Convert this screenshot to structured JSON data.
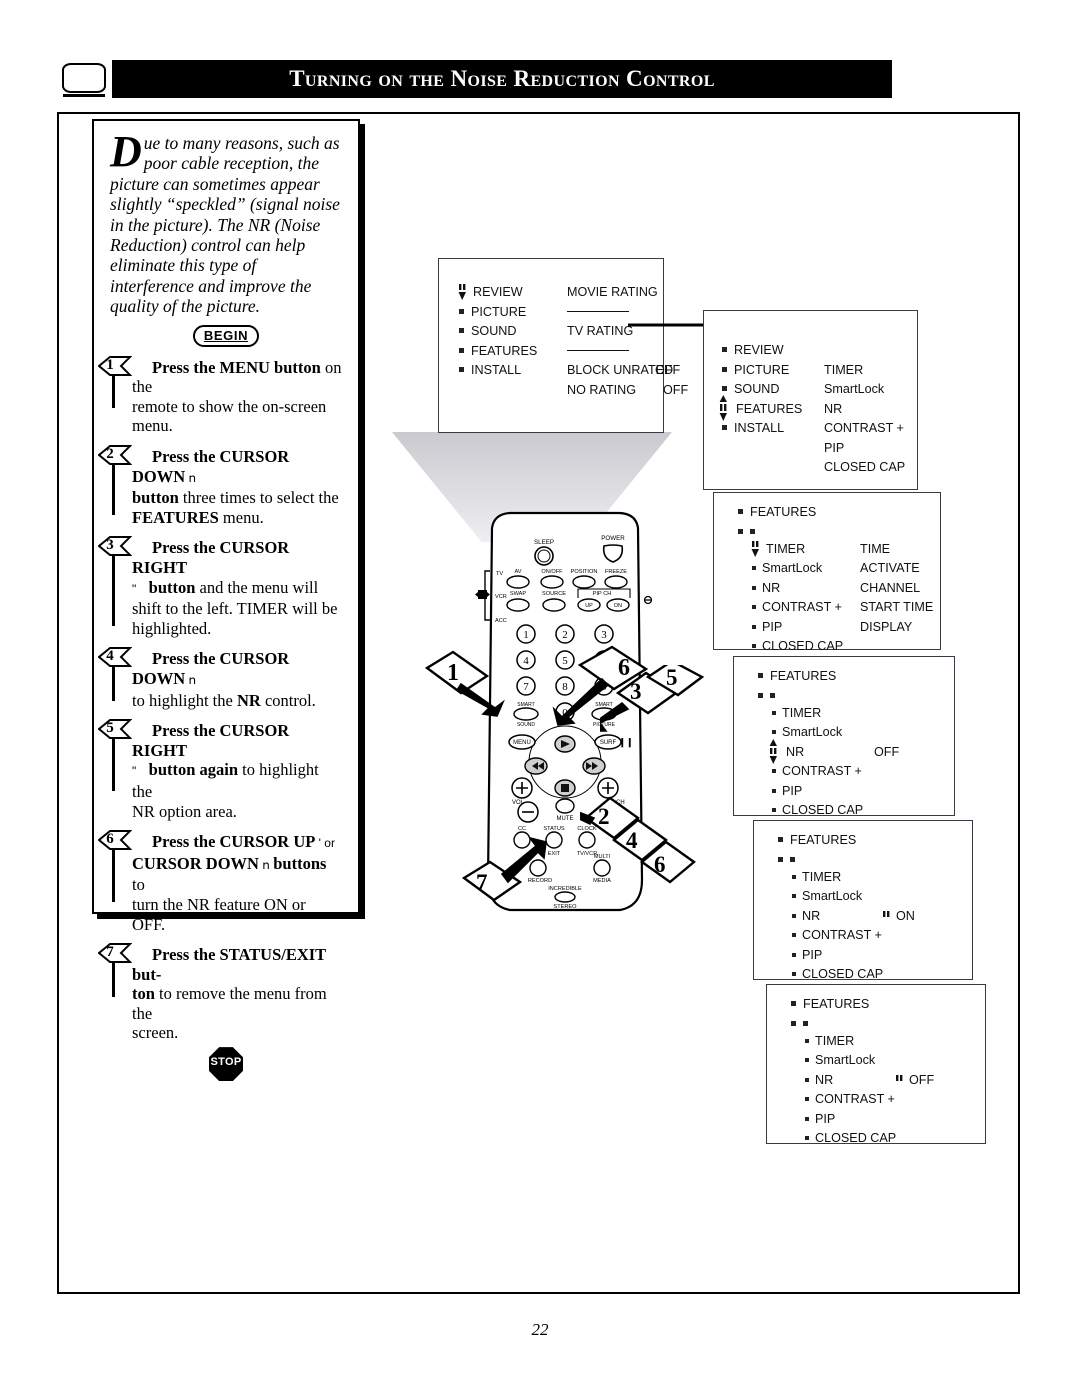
{
  "header": {
    "title": "Turning on the Noise Reduction Control",
    "tv_icon": "tv-screen-icon"
  },
  "instructions": {
    "intro_dropcap": "D",
    "intro_text": "ue to many reasons, such as poor cable reception, the picture can sometimes appear slightly “speckled” (signal noise in the picture). The NR (Noise Reduction) control can help eliminate this type of interference and improve the quality of the picture.",
    "begin_label": "BEGIN",
    "stop_label": "STOP",
    "steps": [
      {
        "number": "1",
        "line1_bold": "Press the MENU button",
        "line1_rest": " on the",
        "line2": "remote to show the on-screen menu."
      },
      {
        "number": "2",
        "line1_bold": "Press the CURSOR DOWN",
        "line1_rest": " ո",
        "line2_bold": "button",
        "line2_rest": " three times to select the",
        "line3_bold": "FEATURES",
        "line3_rest": " menu."
      },
      {
        "number": "3",
        "line1_bold": "Press the CURSOR RIGHT",
        "line2_pre": "\"",
        "line2_bold": "button",
        "line2_rest": " and the menu will",
        "line3": "shift to the left. TIMER will be",
        "line4": "highlighted."
      },
      {
        "number": "4",
        "line1_bold": "Press the CURSOR DOWN",
        "line1_rest": " ո",
        "line2_pre": "to highlight the ",
        "line2_bold": "NR",
        "line2_rest": " control."
      },
      {
        "number": "5",
        "line1_bold": "Press the CURSOR RIGHT",
        "line2_pre": "\"",
        "line2_bold": "button again",
        "line2_rest": " to highlight the",
        "line3": "NR option area."
      },
      {
        "number": "6",
        "line1_bold": "Press the CURSOR UP",
        "line1_rest": " '    or",
        "line2_bold": "CURSOR DOWN",
        "line2_mid": " ո ",
        "line2_bold2": "buttons",
        "line2_rest": " to",
        "line3": "turn the NR feature ON or OFF."
      },
      {
        "number": "7",
        "line1_bold": "Press the STATUS/EXIT but-",
        "line2_bold": "ton",
        "line2_rest": " to remove the menu from the",
        "line3": "screen."
      }
    ]
  },
  "osd_screens": [
    {
      "id": "menu-main-ratings",
      "left_column": [
        "REVIEW",
        "PICTURE",
        "SOUND",
        "FEATURES",
        "INSTALL"
      ],
      "right_column": [
        {
          "label": "MOVIE RATING",
          "value": ""
        },
        {
          "label": "————",
          "value": ""
        },
        {
          "label": "TV RATING",
          "value": ""
        },
        {
          "label": "————",
          "value": ""
        },
        {
          "label": "BLOCK UNRATED",
          "value": "OFF"
        },
        {
          "label": "NO RATING",
          "value": "OFF"
        }
      ],
      "cursor_on": "REVIEW"
    },
    {
      "id": "menu-features-list",
      "left_column": [
        "REVIEW",
        "PICTURE",
        "SOUND",
        "FEATURES",
        "INSTALL"
      ],
      "right_column": [
        {
          "label": "",
          "value": ""
        },
        {
          "label": "TIMER",
          "value": ""
        },
        {
          "label": "SmartLock",
          "value": ""
        },
        {
          "label": "NR",
          "value": ""
        },
        {
          "label": "CONTRAST +",
          "value": ""
        },
        {
          "label": "PIP",
          "value": ""
        },
        {
          "label": "CLOSED CAP",
          "value": ""
        }
      ],
      "cursor_on": "FEATURES"
    },
    {
      "id": "menu-timer-highlighted",
      "title": "FEATURES",
      "left_column": [
        "TIMER",
        "SmartLock",
        "NR",
        "CONTRAST +",
        "PIP",
        "CLOSED CAP"
      ],
      "right_column": [
        "TIME",
        "ACTIVATE",
        "CHANNEL",
        "START TIME",
        "DISPLAY",
        ""
      ],
      "cursor_on": "TIMER"
    },
    {
      "id": "menu-nr-off-selected",
      "title": "FEATURES",
      "left_column": [
        "TIMER",
        "SmartLock",
        "NR",
        "CONTRAST +",
        "PIP",
        "CLOSED CAP"
      ],
      "right_column": [
        "",
        "",
        "OFF",
        "",
        "",
        ""
      ],
      "cursor_on": "NR"
    },
    {
      "id": "menu-nr-on",
      "title": "FEATURES",
      "left_column": [
        "TIMER",
        "SmartLock",
        "NR",
        "CONTRAST +",
        "PIP",
        "CLOSED CAP"
      ],
      "right_column": [
        "",
        "",
        "ON",
        "",
        "",
        ""
      ],
      "value_cursor": "ON"
    },
    {
      "id": "menu-nr-off",
      "title": "FEATURES",
      "left_column": [
        "TIMER",
        "SmartLock",
        "NR",
        "CONTRAST +",
        "PIP",
        "CLOSED CAP"
      ],
      "right_column": [
        "",
        "",
        "OFF",
        "",
        "",
        ""
      ],
      "value_cursor": "OFF"
    }
  ],
  "remote": {
    "labels": {
      "sleep": "SLEEP",
      "power": "POWER",
      "tv": "TV",
      "vcr": "VCR",
      "acc": "ACC",
      "av": "AV",
      "onoff": "ON/OFF",
      "position": "POSITION",
      "freeze": "FREEZE",
      "swap": "SWAP",
      "source": "SOURCE",
      "pipch": "PIP CH",
      "up": "UP",
      "dn": "DN",
      "smart_sound": "SMART SOUND",
      "smart_picture": "SMART PICTURE",
      "menu": "MENU",
      "surf": "SURF",
      "vol": "VOL",
      "ch": "CH",
      "mute": "MUTE",
      "cc": "CC",
      "status_exit": "STATUS EXIT",
      "clock": "CLOCK",
      "tv_vcr": "TV/VCR",
      "record": "RECORD",
      "multi_media": "MULTI MEDIA",
      "incredible_stereo": "INCREDIBLE STEREO"
    },
    "keypad": [
      "1",
      "2",
      "3",
      "4",
      "5",
      "6",
      "7",
      "8",
      "9",
      "0"
    ]
  },
  "callouts": [
    {
      "id": "callout-1",
      "text": "1",
      "points_to": "menu-button"
    },
    {
      "id": "callout-6-up",
      "text": "6",
      "points_to": "cursor-up-button"
    },
    {
      "id": "callout-3",
      "text": "3",
      "points_to": "cursor-right-button"
    },
    {
      "id": "callout-5",
      "text": "5",
      "points_to": "cursor-right-button"
    },
    {
      "id": "callout-2",
      "text": "2",
      "points_to": "cursor-down-button"
    },
    {
      "id": "callout-4",
      "text": "4",
      "points_to": "cursor-down-button"
    },
    {
      "id": "callout-6-down",
      "text": "6",
      "points_to": "cursor-down-button"
    },
    {
      "id": "callout-7",
      "text": "7",
      "points_to": "status-exit-button"
    }
  ],
  "footer": {
    "page_number": "22"
  }
}
